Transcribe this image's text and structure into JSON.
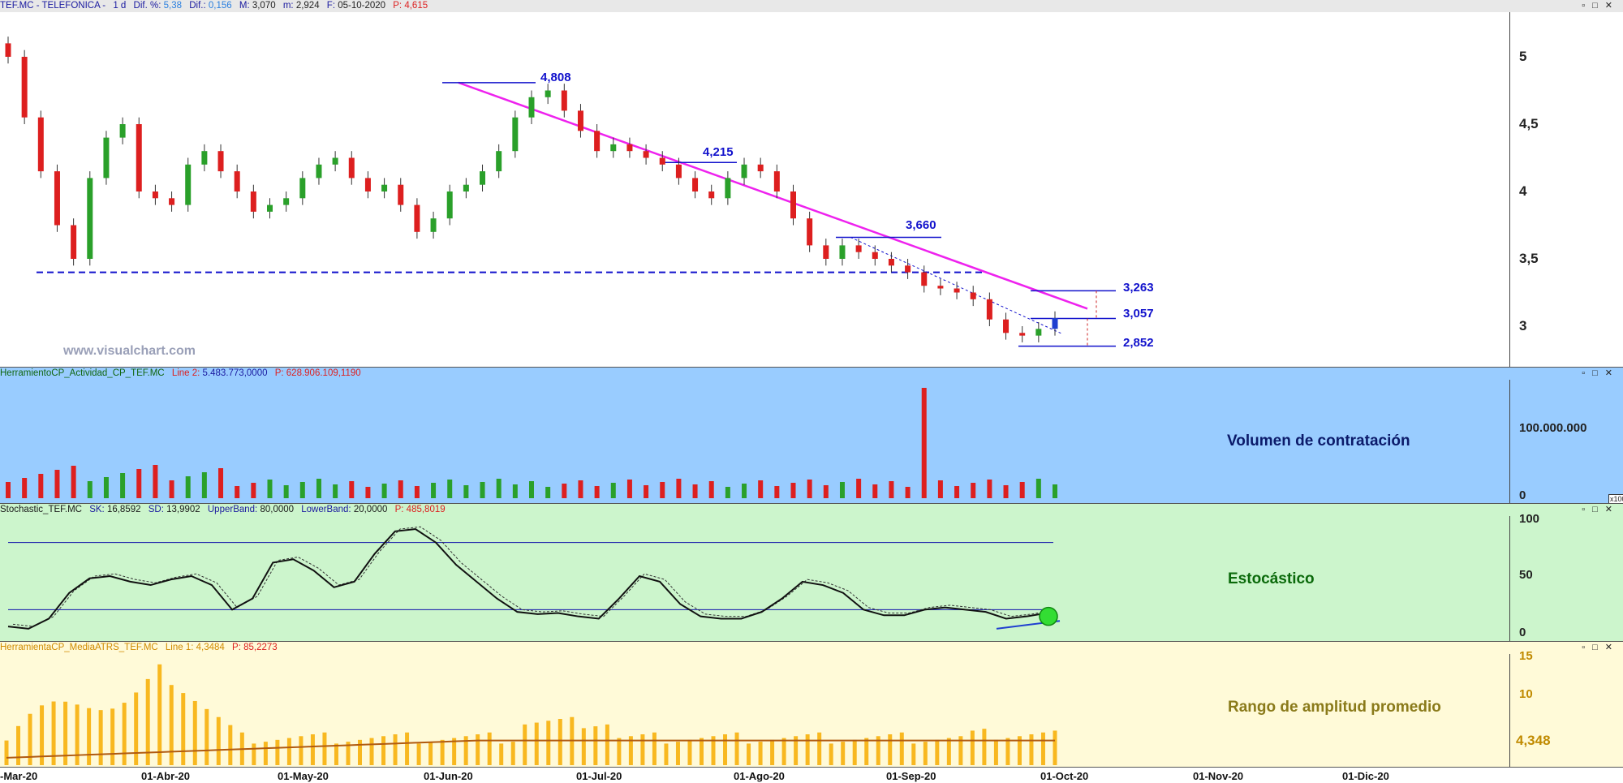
{
  "panes": {
    "price": {
      "header": {
        "symbol": "TEF.MC - TELEFONICA -",
        "interval": "1 d",
        "dif_pct_label": "Dif. %:",
        "dif_pct": "5,38",
        "dif_label": "Dif.:",
        "dif": "0,156",
        "max_label": "M:",
        "max": "3,070",
        "min_label": "m:",
        "min": "2,924",
        "date_label": "F:",
        "date": "05-10-2020",
        "p_label": "P:",
        "p": "4,615"
      },
      "y_ticks": [
        "5",
        "4,5",
        "4",
        "3,5",
        "3"
      ],
      "levels": [
        "4,808",
        "4,215",
        "3,660",
        "3,263",
        "3,057",
        "2,852"
      ],
      "watermark": "www.visualchart.com"
    },
    "volume": {
      "header": {
        "name": "HerramientoCP_Actividad_CP_TEF.MC",
        "line_label": "Line 2:",
        "line_value": "5.483.773,0000",
        "p_label": "P:",
        "p": "628.906.109,1190"
      },
      "title": "Volumen de contratación",
      "y_ticks": [
        "100.000.000",
        "0"
      ],
      "scale_badge": "x100"
    },
    "stochastic": {
      "header": {
        "name": "Stochastic_TEF.MC",
        "sk_label": "SK:",
        "sk": "16,8592",
        "sd_label": "SD:",
        "sd": "13,9902",
        "upper_label": "UpperBand:",
        "upper": "80,0000",
        "lower_label": "LowerBand:",
        "lower": "20,0000",
        "p_label": "P:",
        "p": "485,8019"
      },
      "title": "Estocástico",
      "y_ticks": [
        "100",
        "50",
        "0"
      ]
    },
    "atr": {
      "header": {
        "name": "HerramientaCP_MediaATRS_TEF.MC",
        "line_label": "Line 1:",
        "line_value": "4,3484",
        "p_label": "P:",
        "p": "85,2273"
      },
      "title": "Rango de amplitud promedio",
      "y_ticks": [
        "15",
        "10",
        "4,348"
      ]
    }
  },
  "x_labels": [
    "-Mar-20",
    "01-Abr-20",
    "01-May-20",
    "01-Jun-20",
    "01-Jul-20",
    "01-Ago-20",
    "01-Sep-20",
    "01-Oct-20",
    "01-Nov-20",
    "01-Dic-20"
  ],
  "colors": {
    "up": "#2aa02a",
    "down": "#dd1f1f",
    "last": "#1f3fd0",
    "trend": "#ee22ee",
    "support": "#1111cc",
    "vol_bg": "#99ccff",
    "stoch_bg": "#ccf5cc",
    "atr_bg": "#fffad8",
    "atr_bar": "#f8b820",
    "atr_line": "#b05a10"
  },
  "chart_data": [
    {
      "type": "candlestick",
      "series": [
        {
          "name": "TEF.MC",
          "close": [
            5.0,
            4.55,
            4.15,
            3.75,
            3.5,
            4.1,
            4.4,
            4.5,
            4.0,
            3.95,
            3.9,
            4.2,
            4.3,
            4.15,
            4.0,
            3.85,
            3.9,
            3.95,
            4.1,
            4.2,
            4.25,
            4.1,
            4.0,
            4.05,
            3.9,
            3.7,
            3.8,
            4.0,
            4.05,
            4.15,
            4.3,
            4.55,
            4.7,
            4.75,
            4.6,
            4.45,
            4.3,
            4.35,
            4.3,
            4.25,
            4.2,
            4.1,
            4.0,
            3.95,
            4.1,
            4.2,
            4.15,
            4.0,
            3.8,
            3.6,
            3.5,
            3.6,
            3.55,
            3.5,
            3.45,
            3.4,
            3.3,
            3.28,
            3.25,
            3.2,
            3.05,
            2.95,
            2.93,
            2.98,
            3.06
          ]
        }
      ],
      "levels": [
        4.808,
        4.215,
        3.66,
        3.263,
        3.057,
        2.852
      ],
      "support": 3.4,
      "ylim": [
        2.7,
        5.3
      ]
    },
    {
      "type": "bar",
      "name": "Volumen de contratación",
      "spike": 140000000,
      "ylim": [
        0,
        140000000
      ]
    },
    {
      "type": "line",
      "name": "Estocástico",
      "series": [
        {
          "name": "SK",
          "values": [
            5,
            3,
            12,
            35,
            48,
            50,
            45,
            42,
            47,
            50,
            42,
            20,
            30,
            62,
            65,
            55,
            40,
            45,
            70,
            90,
            92,
            80,
            60,
            45,
            30,
            18,
            16,
            17,
            14,
            12,
            30,
            50,
            45,
            25,
            14,
            12,
            12,
            18,
            30,
            45,
            42,
            35,
            20,
            15,
            15,
            20,
            22,
            20,
            18,
            12,
            14,
            17
          ]
        }
      ],
      "upper_band": 80,
      "lower_band": 20,
      "ylim": [
        0,
        100
      ]
    },
    {
      "type": "bar",
      "name": "Rango de amplitud promedio",
      "last": 4.348,
      "ylim": [
        0,
        15
      ]
    }
  ]
}
